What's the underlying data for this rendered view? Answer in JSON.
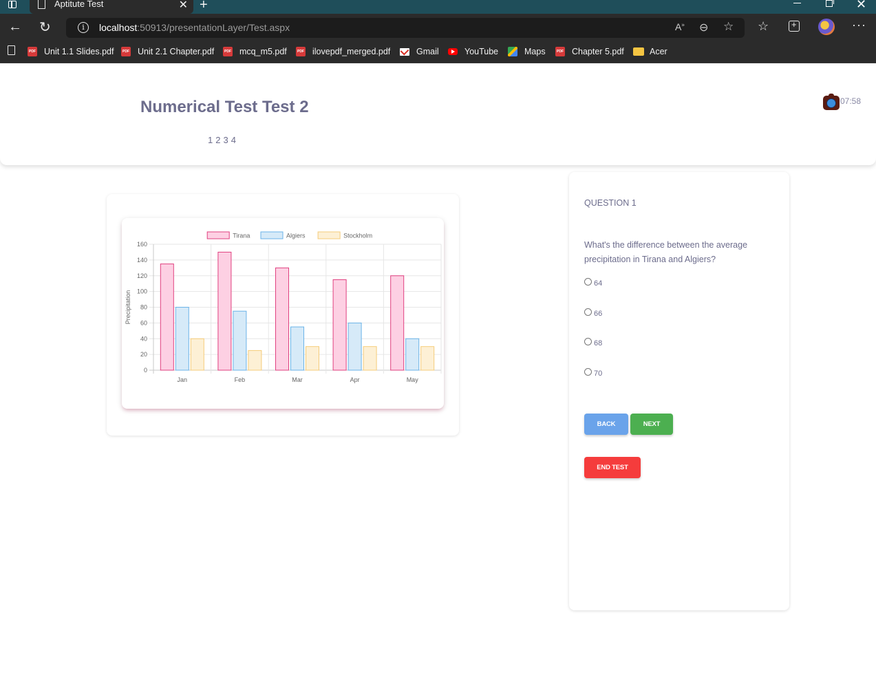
{
  "browser": {
    "tab_title": "Aptitute Test",
    "url_host": "localhost",
    "url_rest": ":50913/presentationLayer/Test.aspx",
    "bookmarks": [
      {
        "label": "Unit 1.1 Slides.pdf",
        "icon": "pdf-icon"
      },
      {
        "label": "Unit 2.1 Chapter.pdf",
        "icon": "pdf-icon"
      },
      {
        "label": "mcq_m5.pdf",
        "icon": "pdf-icon"
      },
      {
        "label": "ilovepdf_merged.pdf",
        "icon": "pdf-icon"
      },
      {
        "label": "Gmail",
        "icon": "gmail-icon"
      },
      {
        "label": "YouTube",
        "icon": "youtube-icon"
      },
      {
        "label": "Maps",
        "icon": "maps-icon"
      },
      {
        "label": "Chapter 5.pdf",
        "icon": "pdf-icon"
      },
      {
        "label": "Acer",
        "icon": "folder-icon"
      }
    ]
  },
  "header": {
    "title": "Numerical Test Test 2",
    "pages": [
      "1",
      "2",
      "3",
      "4"
    ],
    "timer": "07:58"
  },
  "chart_data": {
    "type": "bar",
    "categories": [
      "Jan",
      "Feb",
      "Mar",
      "Apr",
      "May"
    ],
    "series": [
      {
        "name": "Tirana",
        "values": [
          135,
          150,
          130,
          115,
          120
        ],
        "fill": "#fdd0e3",
        "stroke": "#e0407f"
      },
      {
        "name": "Algiers",
        "values": [
          80,
          75,
          55,
          60,
          40
        ],
        "fill": "#d6eaf8",
        "stroke": "#6bb3e8"
      },
      {
        "name": "Stockholm",
        "values": [
          40,
          25,
          30,
          30,
          30
        ],
        "fill": "#fdf0d5",
        "stroke": "#f5cc7a"
      }
    ],
    "ylabel": "Precipitation",
    "yticks": [
      0,
      20,
      40,
      60,
      80,
      100,
      120,
      140,
      160
    ],
    "ylim": [
      0,
      160
    ],
    "legend": "top",
    "grid": true
  },
  "question": {
    "number_label": "QUESTION 1",
    "text": "What's the difference between the average precipitation in Tirana and Algiers?",
    "options": [
      "64",
      "66",
      "68",
      "70"
    ],
    "back_label": "BACK",
    "next_label": "NEXT",
    "end_label": "END TEST"
  }
}
